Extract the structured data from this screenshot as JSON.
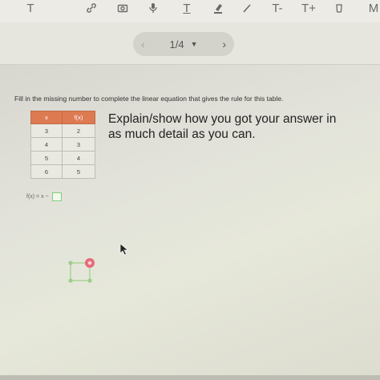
{
  "toolbar": {
    "tools": [
      {
        "name": "text-t-icon",
        "label": "T"
      },
      {
        "name": "link-icon",
        "label": ""
      },
      {
        "name": "camera-icon",
        "label": ""
      },
      {
        "name": "microphone-icon",
        "label": ""
      },
      {
        "name": "underline-text-icon",
        "label": "T"
      },
      {
        "name": "highlighter-icon",
        "label": ""
      },
      {
        "name": "pencil-icon",
        "label": ""
      },
      {
        "name": "text-decrease-icon",
        "label": "T-"
      },
      {
        "name": "text-increase-icon",
        "label": "T+"
      },
      {
        "name": "trash-icon",
        "label": ""
      },
      {
        "name": "more-menu-icon",
        "label": "M"
      }
    ]
  },
  "pager": {
    "prev": "‹",
    "current": "1/4",
    "caret": "▼",
    "next": "›"
  },
  "worksheet": {
    "instruction": "Fill in the missing number to complete the linear equation that gives the rule for this table.",
    "table": {
      "headers": [
        "x",
        "f(x)"
      ],
      "rows": [
        [
          "3",
          "2"
        ],
        [
          "4",
          "3"
        ],
        [
          "5",
          "4"
        ],
        [
          "6",
          "5"
        ]
      ]
    },
    "explain_line1": "Explain/show how you got your answer in",
    "explain_line2": "as much detail as you can.",
    "formula_text": "f(x) = x −",
    "answer_value": ""
  },
  "colors": {
    "table_header": "#dd7a52",
    "answer_box_border": "#7dd07a",
    "handle_accent": "#e86a7a"
  }
}
